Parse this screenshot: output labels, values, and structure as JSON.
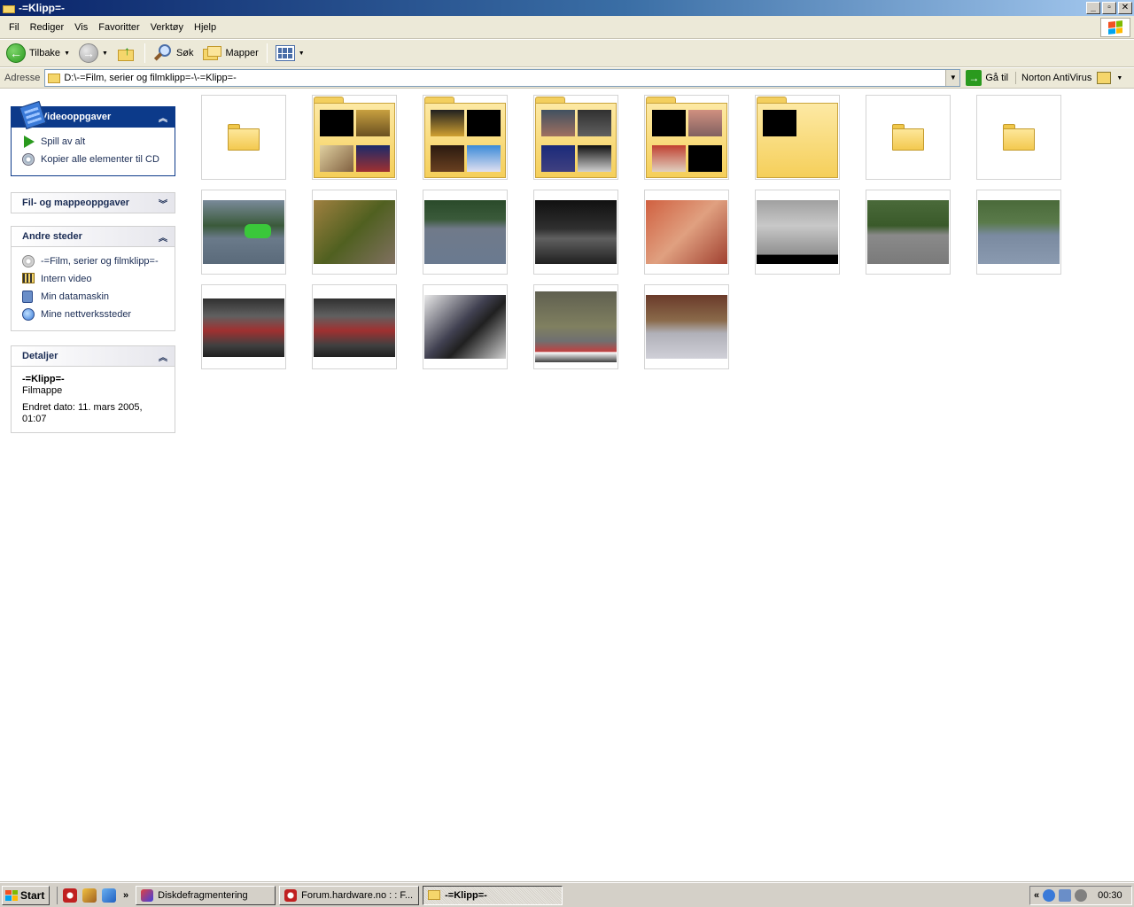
{
  "window": {
    "title": "-=Klipp=-",
    "min": "_",
    "max": "▫",
    "close": "✕"
  },
  "menu": [
    "Fil",
    "Rediger",
    "Vis",
    "Favoritter",
    "Verktøy",
    "Hjelp"
  ],
  "toolbar": {
    "back_label": "Tilbake",
    "search_label": "Søk",
    "folders_label": "Mapper"
  },
  "address": {
    "label": "Adresse",
    "path": "D:\\-=Film, serier og filmklipp=-\\-=Klipp=-",
    "go_label": "Gå til",
    "norton_label": "Norton AntiVirus"
  },
  "tasks": {
    "video": {
      "title": "Videooppgaver",
      "items": [
        "Spill av alt",
        "Kopier alle elementer til CD"
      ]
    },
    "file": {
      "title": "Fil- og mappeoppgaver"
    },
    "other": {
      "title": "Andre steder",
      "items": [
        "-=Film, serier og filmklipp=-",
        "Intern video",
        "Min datamaskin",
        "Mine nettverkssteder"
      ]
    },
    "details": {
      "title": "Detaljer",
      "name": "-=Klipp=-",
      "type": "Filmappe",
      "modified": "Endret dato: 11. mars 2005, 01:07"
    }
  },
  "taskbar": {
    "start": "Start",
    "quicklaunch_more": "»",
    "buttons": [
      "Diskdefragmentering",
      "Forum.hardware.no : : F...",
      "-=Klipp=-"
    ],
    "tray_collapse": "«",
    "clock": "00:30"
  },
  "colors": {
    "title_start": "#0a246a",
    "title_end": "#a6caf0",
    "panel_dark": "#0c3a8a",
    "folder_yellow": "#f5cf5a"
  },
  "icons": [
    "folder-icon",
    "back-arrow-icon",
    "forward-arrow-icon",
    "up-folder-icon",
    "search-icon",
    "folders-icon",
    "views-icon",
    "go-arrow-icon",
    "play-icon",
    "cd-burn-icon",
    "cd-icon",
    "video-folder-icon",
    "computer-icon",
    "network-icon",
    "windows-logo-icon"
  ]
}
